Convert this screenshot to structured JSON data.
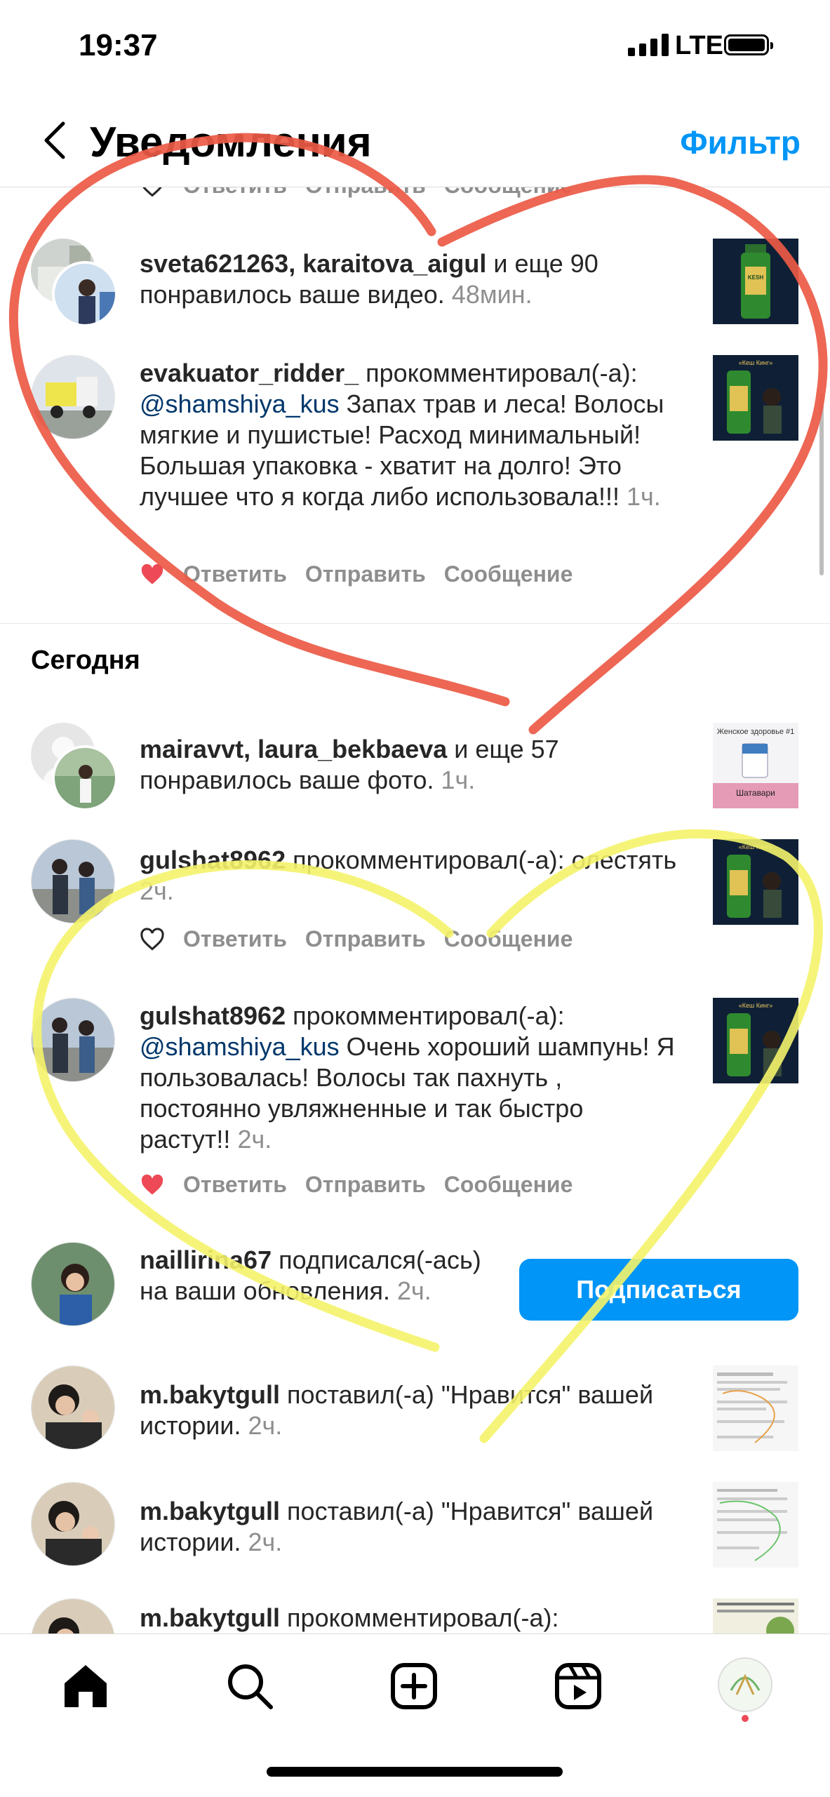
{
  "status": {
    "time": "19:37",
    "network": "LTE"
  },
  "header": {
    "title": "Уведомления",
    "filter": "Фильтр"
  },
  "actions": {
    "reply": "Ответить",
    "send": "Отправить",
    "message": "Сообщение"
  },
  "section_today": "Сегодня",
  "n1": {
    "users": "sveta621263, karaitova_aigul",
    "rest": " и еще 90 понравилось ваше видео. ",
    "time": "48мин."
  },
  "n2": {
    "user": "evakuator_ridder_",
    "verb": " прокомментировал(-а): ",
    "mention": "@shamshiya_kus",
    "text": " Запах трав и леса! Волосы мягкие и пушистые! Расход минимальный! Большая упаковка - хватит на долго! Это лучшее что я когда либо использовала!!! ",
    "time": "1ч."
  },
  "n3": {
    "users": "mairavvt, laura_bekbaeva",
    "rest": " и еще 57 понравилось ваше фото. ",
    "time": "1ч.",
    "thumb_title": "Женское здоровье #1",
    "thumb_caption": "Шатавари"
  },
  "n4": {
    "user": "gulshat8962",
    "verb": " прокомментировал(-а): ",
    "text": "олестять ",
    "time": "2ч."
  },
  "n5": {
    "user": "gulshat8962",
    "verb": " прокомментировал(-а): ",
    "mention": "@shamshiya_kus",
    "text": " Очень хороший шампунь! Я пользовалась! Волосы так пахнуть , постоянно увляжненные и так быстро растут!! ",
    "time": "2ч."
  },
  "n6": {
    "user": "naillirina67",
    "verb": " подписался(-ась) на ваши обновления. ",
    "time": "2ч.",
    "button": "Подписаться"
  },
  "n7": {
    "user": "m.bakytgull",
    "verb": " поставил(-а) \"Нравится\" вашей истории. ",
    "time": "2ч."
  },
  "n8": {
    "user": "m.bakytgull",
    "verb": " поставил(-а) \"Нравится\" вашей истории. ",
    "time": "2ч."
  },
  "n9": {
    "user": "m.bakytgull",
    "verb": " прокомментировал(-а):"
  },
  "thumb_label": "«Кеш Кинг»",
  "tabs": [
    "home-icon",
    "search-icon",
    "create-icon",
    "reels-icon",
    "profile-avatar"
  ],
  "colors": {
    "accent": "#0095f6",
    "like": "#ed4956",
    "red_drawing": "#ec5a45",
    "yellow_drawing": "#f4f36a"
  }
}
